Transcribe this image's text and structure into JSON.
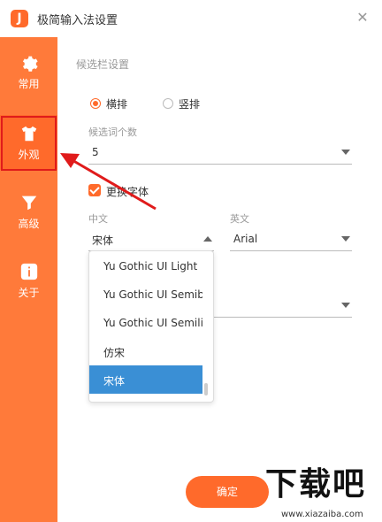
{
  "window": {
    "logo": "J",
    "title": "极简输入法设置",
    "close_glyph": "✕"
  },
  "sidebar": {
    "items": [
      {
        "label": "常用",
        "icon": "gear-icon"
      },
      {
        "label": "外观",
        "icon": "shirt-icon"
      },
      {
        "label": "高级",
        "icon": "filter-icon"
      },
      {
        "label": "关于",
        "icon": "info-icon"
      }
    ],
    "active_index": 1
  },
  "candidate_bar": {
    "section_title": "候选栏设置",
    "orientation": {
      "options": [
        "横排",
        "竖排"
      ],
      "selected": "横排"
    },
    "count_label": "候选词个数",
    "count_value": "5"
  },
  "font": {
    "replace_checkbox_label": "更换字体",
    "replace_checked": true,
    "chinese_label": "中文",
    "chinese_value": "宋体",
    "english_label": "英文",
    "english_value": "Arial",
    "dropdown_options": [
      "Yu Gothic UI Light",
      "Yu Gothic UI Semib",
      "Yu Gothic UI Semili",
      "仿宋",
      "宋体"
    ],
    "dropdown_selected": "宋体"
  },
  "footer": {
    "confirm_label": "确定"
  },
  "watermark": {
    "brand": "下载吧",
    "url": "www.xiazaiba.com"
  },
  "colors": {
    "sidebar": "#ff7a3a",
    "accent": "#ff6a2b",
    "selection": "#3a8fd5",
    "annotation_red": "#e01b1b"
  }
}
